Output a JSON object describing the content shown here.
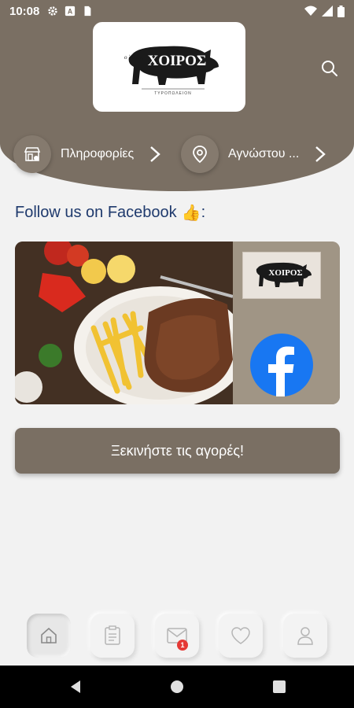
{
  "status_bar": {
    "time": "10:08",
    "icons": [
      "gear-icon",
      "a-icon",
      "sd-card-icon",
      "wifi-icon",
      "signal-icon",
      "battery-icon"
    ]
  },
  "header": {
    "logo_brand": "ΧΟΙΡΟΣ",
    "logo_prefix": "ο ΄Αλλος",
    "logo_subtitle": "ΤΥΡΟΠΩΛΕΙΟΝ",
    "info_pill": {
      "label": "Πληροφορίες",
      "icon": "store-icon"
    },
    "location_pill": {
      "label": "Αγνώστου ...",
      "icon": "location-pin-icon"
    }
  },
  "facebook": {
    "title": "Follow us on Facebook",
    "emoji": "👍",
    "suffix": ":"
  },
  "cta": {
    "label": "Ξεκινήστε τις αγορές!"
  },
  "bottom_nav": {
    "items": [
      {
        "name": "home",
        "icon": "home-icon",
        "active": true
      },
      {
        "name": "orders",
        "icon": "clipboard-icon",
        "active": false
      },
      {
        "name": "messages",
        "icon": "mail-icon",
        "active": false,
        "badge": "1"
      },
      {
        "name": "favorites",
        "icon": "heart-icon",
        "active": false
      },
      {
        "name": "profile",
        "icon": "user-icon",
        "active": false
      }
    ]
  },
  "colors": {
    "brand": "#7a6f63",
    "background": "#f2f2f2",
    "facebook_blue": "#1877f2",
    "title_blue": "#1f3a6d",
    "badge_red": "#e53935"
  }
}
